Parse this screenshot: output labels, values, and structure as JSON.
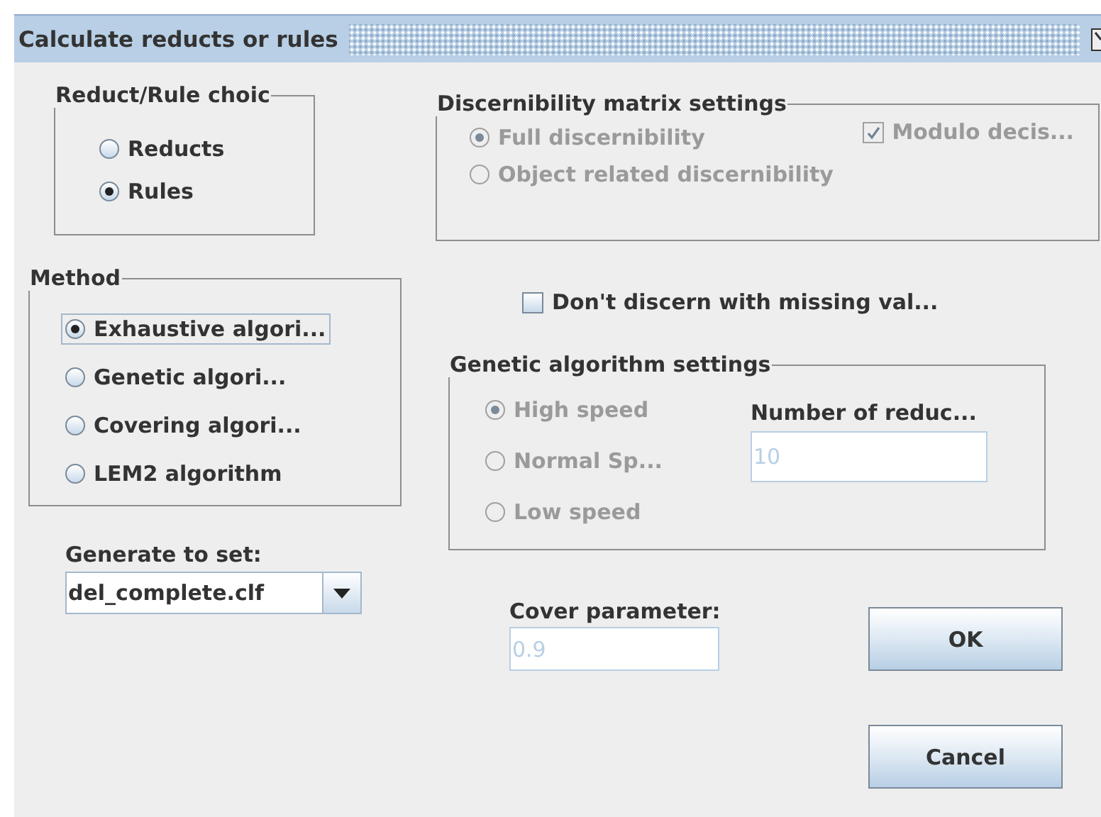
{
  "window": {
    "title": "Calculate reducts or rules"
  },
  "reduct_rule_choice": {
    "title": "Reduct/Rule choic",
    "options": [
      {
        "label": "Reducts",
        "selected": false
      },
      {
        "label": "Rules",
        "selected": true
      }
    ]
  },
  "method": {
    "title": "Method",
    "options": [
      {
        "label": "Exhaustive algori...",
        "selected": true,
        "focused": true
      },
      {
        "label": "Genetic algori...",
        "selected": false,
        "focused": false
      },
      {
        "label": "Covering algori...",
        "selected": false,
        "focused": false
      },
      {
        "label": "LEM2 algorithm",
        "selected": false,
        "focused": false
      }
    ]
  },
  "generate_to_set": {
    "label": "Generate to set:",
    "value": "del_complete.clf"
  },
  "discernibility_matrix_settings": {
    "title": "Discernibility matrix settings",
    "disabled": true,
    "options": [
      {
        "label": "Full discernibility",
        "selected": true
      },
      {
        "label": "Object related discernibility",
        "selected": false
      }
    ],
    "modulo_decision": {
      "label": "Modulo decis...",
      "checked": true
    }
  },
  "missing_values": {
    "label": "Don't discern with missing val...",
    "checked": false
  },
  "genetic_algorithm_settings": {
    "title": "Genetic algorithm settings",
    "disabled": true,
    "speeds": [
      {
        "label": "High speed",
        "selected": true
      },
      {
        "label": "Normal Sp...",
        "selected": false
      },
      {
        "label": "Low speed",
        "selected": false
      }
    ],
    "number_of_reducts": {
      "label": "Number of reduc...",
      "value": "10",
      "disabled": true
    }
  },
  "cover_parameter": {
    "label": "Cover parameter:",
    "value": "0.9",
    "disabled": true
  },
  "buttons": [
    {
      "label": "OK"
    },
    {
      "label": "Cancel"
    }
  ]
}
